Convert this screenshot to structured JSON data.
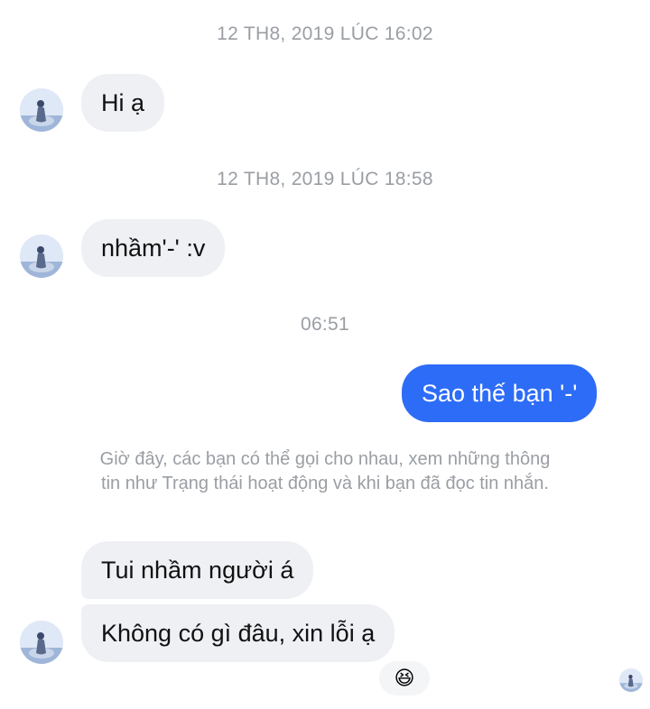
{
  "conversation": {
    "timestamps": {
      "first": "12 TH8, 2019 LÚC 16:02",
      "second": "12 TH8, 2019 LÚC 18:58",
      "third": "06:51"
    },
    "messages": {
      "msg1": "Hi ạ",
      "msg2": "nhầm'-' :v",
      "msg3": "Sao thế bạn '-'",
      "msg4": "Tui nhầm người á",
      "msg5": "Không có gì đâu, xin lỗi ạ"
    },
    "notice": "Giờ đây, các bạn có thể gọi cho nhau, xem những thông tin như Trạng thái hoạt động và khi bạn đã đọc tin nhắn.",
    "reaction": "😆"
  },
  "colors": {
    "incoming_bubble": "#eef0f3",
    "outgoing_bubble": "#2d6cf6",
    "meta_text": "#9a9ea3"
  },
  "icons": {
    "avatar": "contact-avatar-icon",
    "seen": "seen-avatar-icon",
    "reaction": "laughing-emoji-icon"
  }
}
